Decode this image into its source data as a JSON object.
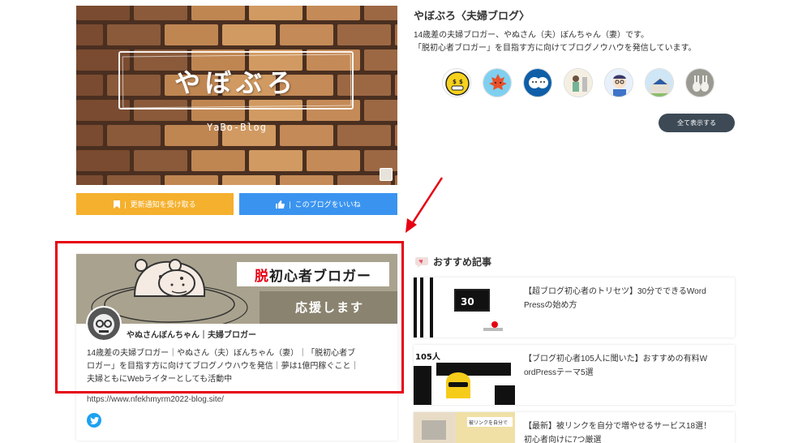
{
  "blog": {
    "cover_title": "やぼぶろ",
    "cover_subtitle": "YaBo-Blog",
    "name": "やぼぶろ〈夫婦ブログ〉",
    "description_line1": "14歳差の夫婦ブロガー、やぬさん（夫）ぼんちゃん（妻）です。",
    "description_line2": "「脱初心者ブロガー」を目指す方に向けてブログノウハウを発信しています。",
    "follow_label": "更新通知を受け取る",
    "like_label": "このブログをいいね",
    "show_all_label": "全て表示する",
    "members": [
      "money-face-avatar",
      "maple-leaf-avatar",
      "couple-avatar",
      "person-illustration-avatar",
      "glasses-man-avatar",
      "house-solar-avatar",
      "rabbits-avatar"
    ]
  },
  "profile": {
    "headline_red": "脱",
    "headline_rest": "初心者ブロガー",
    "sub": "応援します",
    "name": "やぬさんぼんちゃん｜夫婦ブロガー",
    "bio_line1": "14歳差の夫婦ブロガー｜やぬさん（夫）ぼんちゃん（妻）｜「脱初心者ブ",
    "bio_line2": "ロガー」を目指す方に向けてブログノウハウを発信｜夢は1億円稼ぐこと｜",
    "bio_line3": "夫婦ともにWebライターとしても活動中",
    "url": "https://www.nfekhmyrm2022-blog.site/"
  },
  "recommended": {
    "title": "おすすめ記事",
    "items": [
      {
        "line1": "【超ブログ初心者のトリセツ】30分でできるWord",
        "line2": "Pressの始め方",
        "thumb_text": "30"
      },
      {
        "line1": "【ブログ初心者105人に聞いた】おすすめの有料W",
        "line2": "ordPressテーマ5選",
        "thumb_text": "105人"
      },
      {
        "line1": "【最新】被リンクを自分で増やせるサービス18選！",
        "line2": "初心者向けに7つ厳選",
        "thumb_text": "被リンクを自分で"
      }
    ]
  },
  "colors": {
    "accent_red": "#e60012",
    "follow_button": "#f5b02d",
    "like_button": "#3a94ef",
    "show_all_button": "#3d4a56",
    "twitter": "#1da1f2"
  }
}
